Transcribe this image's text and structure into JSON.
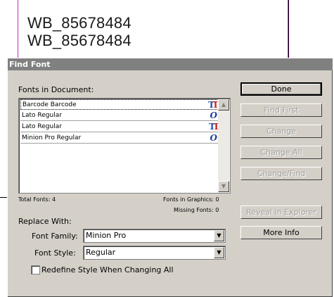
{
  "document": {
    "lines": [
      "WB_85678484",
      "WB_85678484"
    ]
  },
  "dialog": {
    "title": "Find Font",
    "fonts_label": "Fonts in Document:",
    "fonts": [
      {
        "name": "Barcode Barcode",
        "icon": "truetype-icon"
      },
      {
        "name": "Lato Regular",
        "icon": "opentype-icon"
      },
      {
        "name": "Lato Regular",
        "icon": "truetype-icon"
      },
      {
        "name": "Minion Pro Regular",
        "icon": "opentype-icon"
      }
    ],
    "total_fonts": "Total Fonts: 4",
    "fonts_in_graphics": "Fonts in Graphics: 0",
    "missing_fonts": "Missing Fonts: 0",
    "replace_with_label": "Replace With:",
    "font_family_label": "Font Family:",
    "font_family_value": "Minion Pro",
    "font_style_label": "Font Style:",
    "font_style_value": "Regular",
    "redefine_label": "Redefine Style When Changing All",
    "buttons": {
      "done": "Done",
      "find_first": "Find First",
      "change": "Change",
      "change_all": "Change All",
      "change_find": "Change/Find",
      "reveal": "Reveal in Explorer",
      "more_info": "More Info"
    }
  }
}
